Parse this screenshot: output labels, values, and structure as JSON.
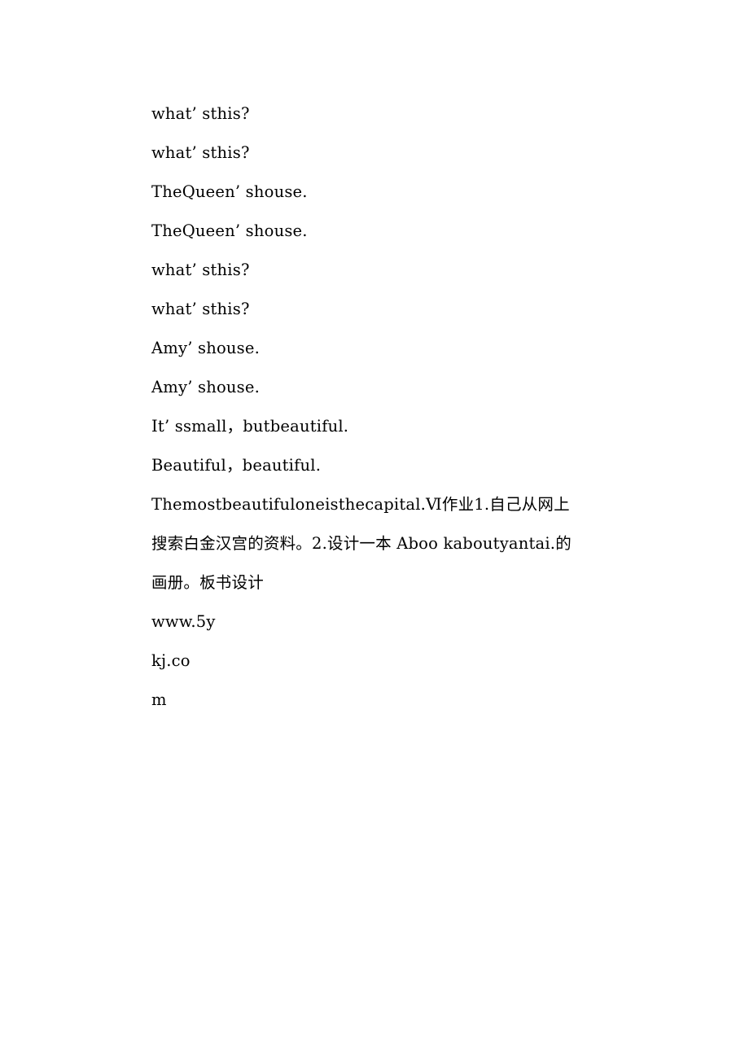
{
  "document": {
    "background_color": "#ffffff",
    "text_color": "#000000",
    "dialogue_lines": [
      "what’ sthis?",
      "what’ sthis?",
      "TheQueen’ shouse.",
      "TheQueen’ shouse.",
      "what’ sthis?",
      "what’ sthis?",
      "Amy’ shouse.",
      "Amy’ shouse.",
      "It’ ssmall，butbeautiful.",
      "Beautiful，beautiful."
    ],
    "homework_paragraph": "Themostbeautifuloneisthecapital.Ⅵ作业1.自己从网上搜索白金汉宫的资料。2.设计一本 Aboo kaboutyantai.的画册。板书设计",
    "url_fragments": [
      "www.5y",
      "kj.co",
      "m"
    ]
  }
}
